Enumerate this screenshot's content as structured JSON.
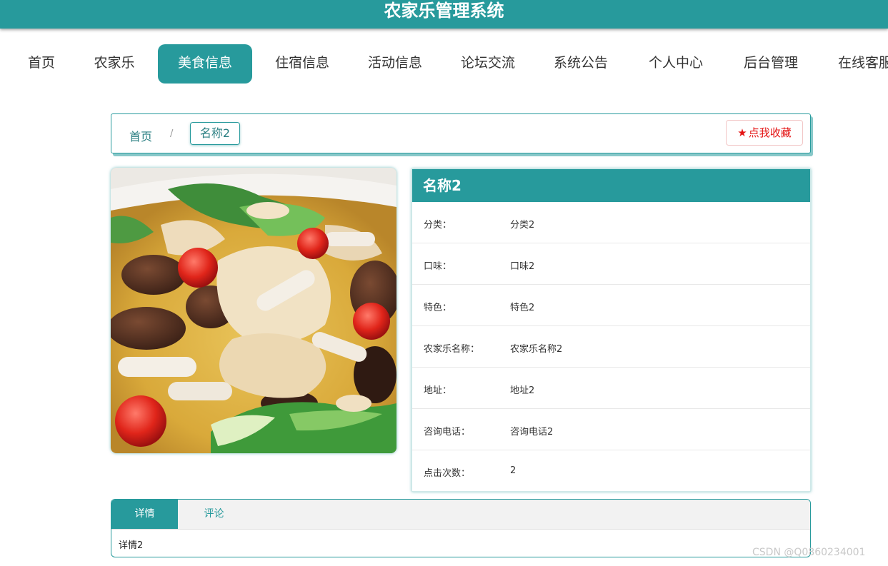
{
  "header": {
    "title": "农家乐管理系统"
  },
  "nav": {
    "items": [
      {
        "label": "首页"
      },
      {
        "label": "农家乐"
      },
      {
        "label": "美食信息",
        "active": true
      },
      {
        "label": "住宿信息"
      },
      {
        "label": "活动信息"
      },
      {
        "label": "论坛交流"
      },
      {
        "label": "系统公告"
      },
      {
        "label": "个人中心"
      },
      {
        "label": "后台管理"
      },
      {
        "label": "在线客服"
      }
    ]
  },
  "breadcrumb": {
    "home": "首页",
    "separator": "/",
    "current": "名称2"
  },
  "favorite": {
    "icon": "star-icon",
    "label": "点我收藏"
  },
  "detail": {
    "name": "名称2",
    "rows": [
      {
        "label": "分类：",
        "value": "分类2"
      },
      {
        "label": "口味：",
        "value": "口味2"
      },
      {
        "label": "特色：",
        "value": "特色2"
      },
      {
        "label": "农家乐名称：",
        "value": "农家乐名称2"
      },
      {
        "label": "地址：",
        "value": "地址2"
      },
      {
        "label": "咨询电话：",
        "value": "咨询电话2"
      },
      {
        "label": "点击次数：",
        "value": "2"
      }
    ]
  },
  "tabs": {
    "items": [
      {
        "label": "详情",
        "active": true
      },
      {
        "label": "评论",
        "active": false
      }
    ],
    "content": "详情2"
  },
  "watermark": "CSDN @Q0860234001",
  "colors": {
    "primary": "#279a9c",
    "favorite": "#e41414"
  }
}
